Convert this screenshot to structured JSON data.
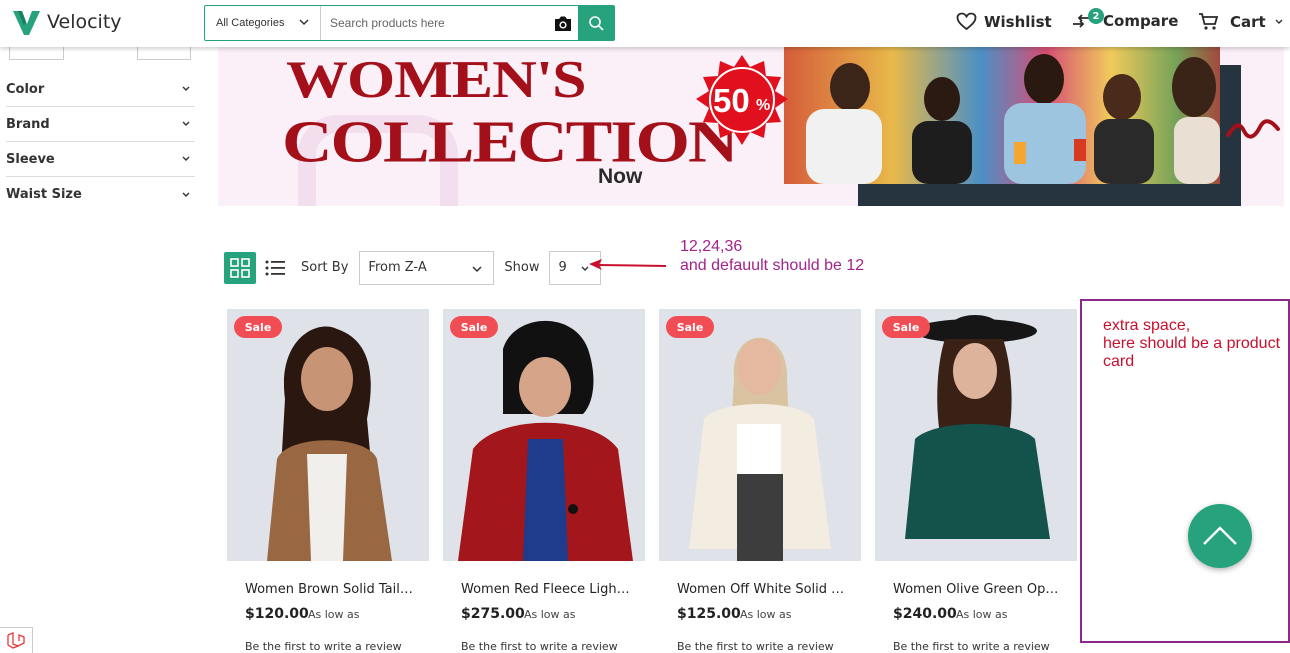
{
  "header": {
    "logo_text": "Velocity",
    "category_select": "All Categories",
    "search_placeholder": "Search products here",
    "wishlist_label": "Wishlist",
    "compare_label": "Compare",
    "compare_count": "2",
    "cart_label": "Cart"
  },
  "sidebar": {
    "filters": [
      {
        "label": "Color"
      },
      {
        "label": "Brand"
      },
      {
        "label": "Sleeve"
      },
      {
        "label": "Waist Size"
      }
    ]
  },
  "banner": {
    "line1": "WOMEN'S",
    "line2": "COLLECTION",
    "line3": "Now",
    "discount": "50",
    "percent": "%"
  },
  "toolbar": {
    "sort_label": "Sort By",
    "sort_value": "From Z-A",
    "show_label": "Show",
    "show_value": "9"
  },
  "annotation": {
    "line1": "12,24,36",
    "line2": "and defauult should be 12",
    "box_line1": "extra space,",
    "box_line2": "here should be a product",
    "box_line3": "card"
  },
  "products": [
    {
      "badge": "Sale",
      "name": "Women Brown Solid Tailored Jacket",
      "price": "$120.00",
      "low": "As low as",
      "review": "Be the first to write a review"
    },
    {
      "badge": "Sale",
      "name": "Women Red Fleece Lightweight Jacket",
      "price": "$275.00",
      "low": "As low as",
      "review": "Be the first to write a review"
    },
    {
      "badge": "Sale",
      "name": "Women Off White Solid Faux Fur Jacket",
      "price": "$125.00",
      "low": "As low as",
      "review": "Be the first to write a review"
    },
    {
      "badge": "Sale",
      "name": "Women Olive Green Open Knit Top",
      "price": "$240.00",
      "low": "As low as",
      "review": "Be the first to write a review"
    }
  ],
  "colors": {
    "accent": "#26a37c",
    "sale": "#f14d54",
    "banner_red": "#a4101a",
    "annotation_purple": "#a2238c",
    "annotation_red": "#c8102e"
  }
}
